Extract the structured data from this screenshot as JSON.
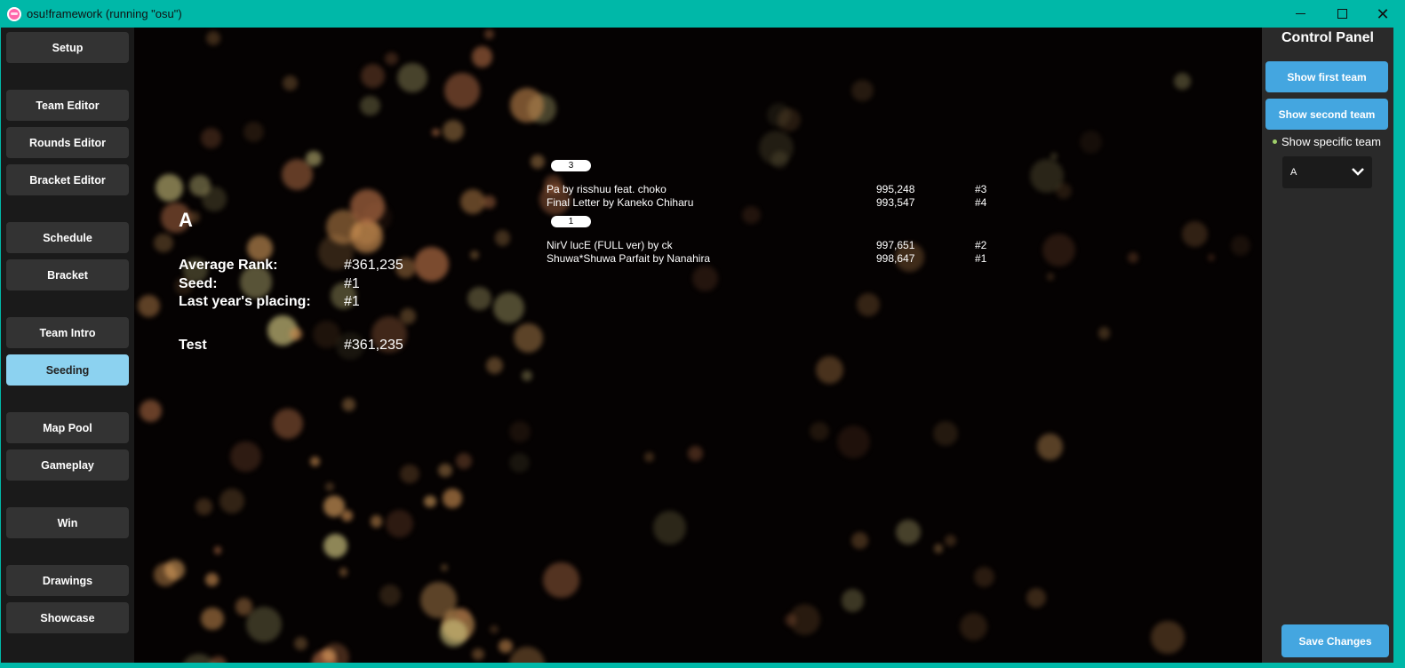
{
  "window": {
    "title": "osu!framework (running \"osu\")"
  },
  "sidebar": {
    "items": [
      {
        "label": "Setup",
        "active": false
      },
      {
        "label": "Team Editor",
        "active": false
      },
      {
        "label": "Rounds Editor",
        "active": false
      },
      {
        "label": "Bracket Editor",
        "active": false
      },
      {
        "label": "Schedule",
        "active": false
      },
      {
        "label": "Bracket",
        "active": false
      },
      {
        "label": "Team Intro",
        "active": false
      },
      {
        "label": "Seeding",
        "active": true
      },
      {
        "label": "Map Pool",
        "active": false
      },
      {
        "label": "Gameplay",
        "active": false
      },
      {
        "label": "Win",
        "active": false
      },
      {
        "label": "Drawings",
        "active": false
      },
      {
        "label": "Showcase",
        "active": false
      }
    ]
  },
  "seeding": {
    "team_name": "A",
    "stats": [
      {
        "label": "Average Rank:",
        "value": "#361,235"
      },
      {
        "label": "Seed:",
        "value": "#1"
      },
      {
        "label": "Last year's placing:",
        "value": "#1"
      },
      {
        "label": "Test",
        "value": "#361,235"
      }
    ],
    "mod_groups": [
      {
        "seed": "3",
        "beatmaps": [
          {
            "title": "Pa by risshuu feat. choko",
            "score": "995,248",
            "rank": "#3"
          },
          {
            "title": "Final Letter by Kaneko Chiharu",
            "score": "993,547",
            "rank": "#4"
          }
        ]
      },
      {
        "seed": "1",
        "beatmaps": [
          {
            "title": "NirV lucE (FULL ver) by ck",
            "score": "997,651",
            "rank": "#2"
          },
          {
            "title": "Shuwa*Shuwa Parfait by Nanahira",
            "score": "998,647",
            "rank": "#1"
          }
        ]
      }
    ]
  },
  "control_panel": {
    "title": "Control Panel",
    "show_first_team": "Show first team",
    "show_second_team": "Show second team",
    "show_specific_team": "Show specific team",
    "selected_team": "A",
    "save_changes": "Save Changes"
  },
  "colors": {
    "title_bar": "#00b8a8",
    "accent_blue": "#44a6e0",
    "active_nav": "#8cd2f0",
    "nav_button": "#333333"
  },
  "icons": {
    "app": "osu-logo-icon",
    "minimize": "minimize-icon",
    "maximize": "maximize-icon",
    "close": "close-icon",
    "dropdown": "chevron-down-icon"
  }
}
